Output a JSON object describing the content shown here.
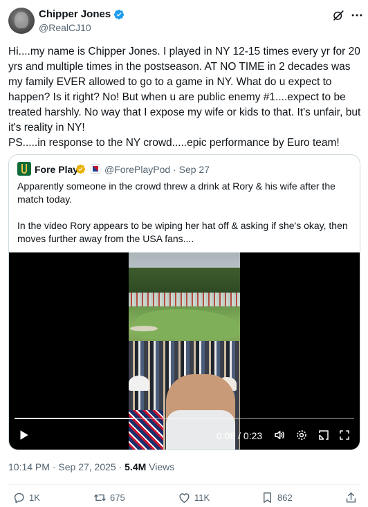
{
  "author": {
    "name": "Chipper Jones",
    "handle": "@RealCJ10",
    "verified_color": "#1d9bf0"
  },
  "tweet": {
    "text": "Hi....my name is Chipper Jones. I played in NY 12-15 times every yr for 20 yrs and multiple times in the postseason. AT NO TIME in 2 decades was my family EVER allowed to go to a game in NY. What do u expect to happen? Is it right? No! But when u are public enemy #1....expect to be treated harshly. No way that I expose my wife or kids to that. It's unfair, but it's reality in NY!\nPS.....in response to the NY crowd.....epic performance by Euro team!"
  },
  "quote": {
    "name": "Fore Play",
    "verified_color": "#e8b100",
    "handle": "@ForePlayPod",
    "dot": "·",
    "date": "Sep 27",
    "text": "Apparently someone in the crowd threw a drink at Rory & his wife after the match today.\n\nIn the video Rory appears to be wiping her hat off & asking if she's okay, then moves further away from the USA fans...."
  },
  "video": {
    "time": "0:08 / 0:23",
    "progress": 0.35,
    "icons": [
      "play-icon",
      "volume-icon",
      "settings-icon",
      "popout-icon",
      "fullscreen-icon"
    ]
  },
  "meta": {
    "time": "10:14 PM",
    "date": "Sep 27, 2025",
    "views_count": "5.4M",
    "views_label": "Views",
    "sep": "·"
  },
  "actions": {
    "replies": "1K",
    "reposts": "675",
    "likes": "11K",
    "bookmarks": "862"
  }
}
